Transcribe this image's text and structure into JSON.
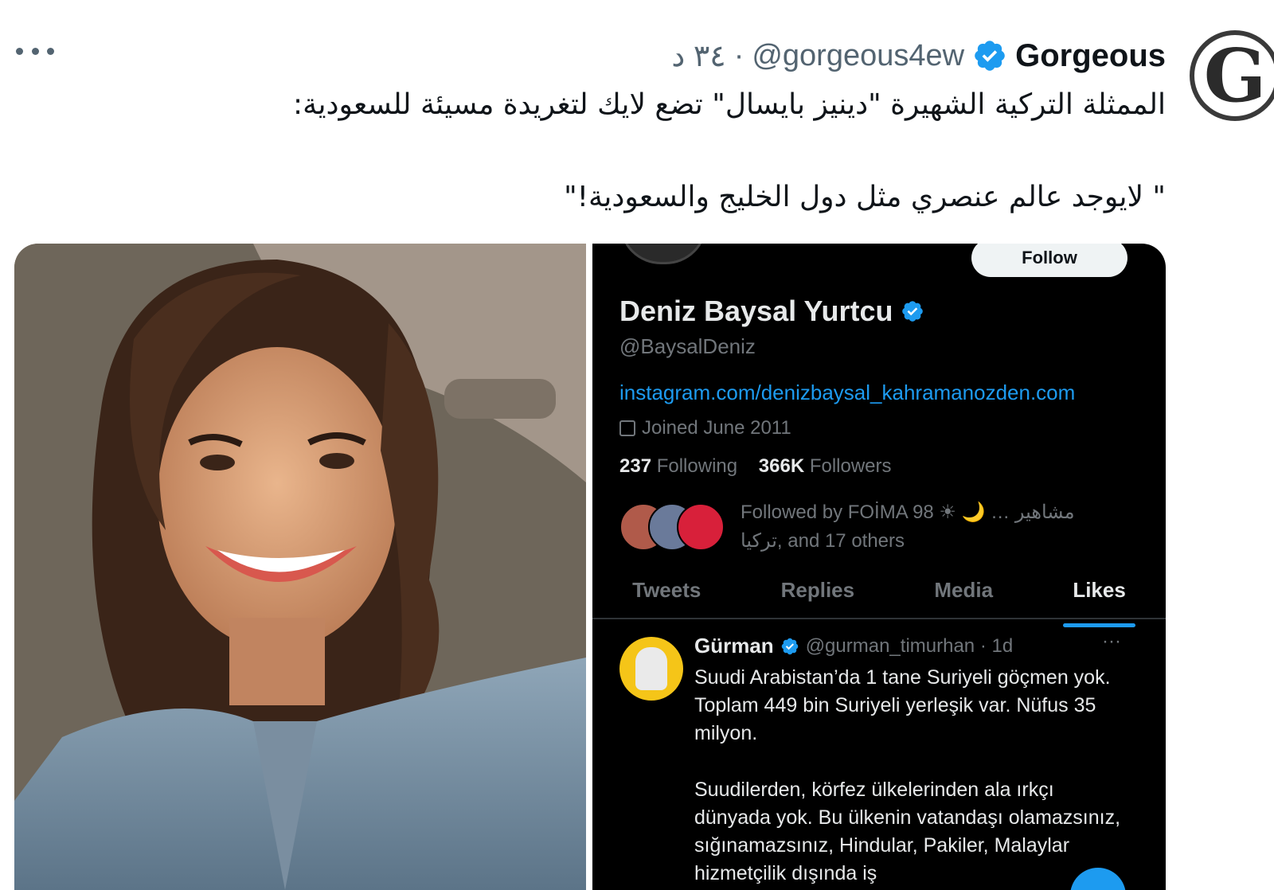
{
  "tweet": {
    "author_name": "Gorgeous",
    "avatar_letter": "G",
    "handle": "@gorgeous4ew",
    "separator": "·",
    "time": "٣٤ د",
    "text_line1": "الممثلة التركية الشهيرة \"دينيز بايسال\" تضع لايك لتغريدة مسيئة للسعودية:",
    "text_line2": "\" لايوجد عالم عنصري مثل دول الخليج والسعودية!\""
  },
  "screenshot": {
    "follow_label": "Follow",
    "profile_name": "Deniz Baysal Yurtcu",
    "profile_handle": "@BaysalDeniz",
    "profile_link": "instagram.com/denizbaysal_kahramanozden.com",
    "joined": "Joined June 2011",
    "following_count": "237",
    "following_label": "Following",
    "followers_count": "366K",
    "followers_label": "Followers",
    "followed_by_line1": "Followed by FOİMA 98 ☀ 🌙 … مشاهير",
    "followed_by_line2": "تركيا, and 17 others",
    "tabs": [
      "Tweets",
      "Replies",
      "Media",
      "Likes"
    ],
    "active_tab": "Likes",
    "liked_tweet": {
      "author": "Gürman",
      "handle_time": "@gurman_timurhan · 1d",
      "more": "···",
      "paragraph1": "Suudi Arabistan’da 1 tane Suriyeli göçmen yok. Toplam 449 bin Suriyeli yerleşik var. Nüfus 35 milyon.",
      "paragraph2": "Suudilerden, körfez ülkelerinden ala ırkçı dünyada yok. Bu ülkenin vatandaşı olamazsınız, sığınamazsınız, Hindular, Pakiler, Malaylar hizmetçilik dışında iş"
    }
  },
  "colors": {
    "accent": "#1d9bf0",
    "text_primary": "#0f1419",
    "text_secondary": "#536471",
    "dark_bg": "#000000"
  },
  "icons": [
    "verified-badge-icon",
    "more-options-icon",
    "calendar-icon"
  ]
}
